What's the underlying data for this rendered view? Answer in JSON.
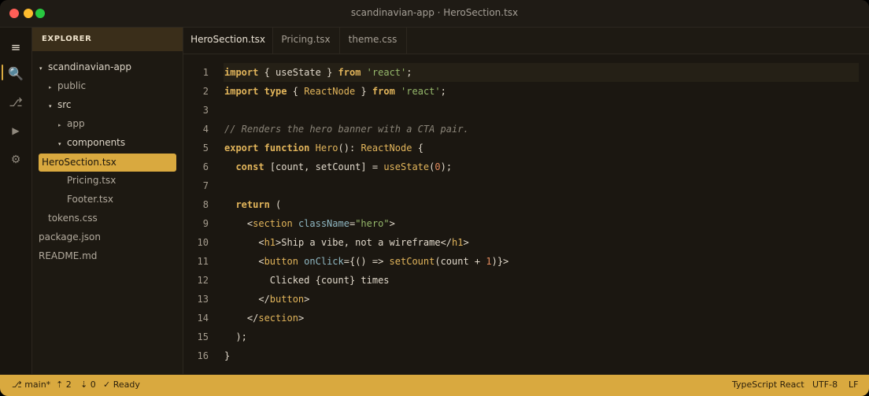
{
  "window": {
    "title": "scandinavian-app · HeroSection.tsx"
  },
  "activity": [
    {
      "icon": "menu-icon",
      "glyph": "≡"
    },
    {
      "icon": "search-icon",
      "glyph": "🔍"
    },
    {
      "icon": "source-control-icon",
      "glyph": "⎇"
    },
    {
      "icon": "run-icon",
      "glyph": "▶"
    },
    {
      "icon": "settings-icon",
      "glyph": "⚙"
    }
  ],
  "explorer": {
    "title": "EXPLORER",
    "tree": [
      {
        "label": "scandinavian-app",
        "caret": "▾"
      },
      {
        "label": "public",
        "caret": "▸"
      },
      {
        "label": "src",
        "caret": "▾"
      },
      {
        "label": "app",
        "caret": "▸"
      },
      {
        "label": "components",
        "caret": "▾"
      },
      {
        "label": "HeroSection.tsx",
        "caret": ""
      },
      {
        "label": "Pricing.tsx",
        "caret": ""
      },
      {
        "label": "Footer.tsx",
        "caret": ""
      },
      {
        "label": "tokens.css",
        "caret": ""
      },
      {
        "label": "package.json",
        "caret": ""
      },
      {
        "label": "README.md",
        "caret": ""
      }
    ]
  },
  "tabs": [
    {
      "label": "HeroSection.tsx",
      "active": true
    },
    {
      "label": "Pricing.tsx",
      "active": false
    },
    {
      "label": "theme.css",
      "active": false
    }
  ],
  "editor": {
    "line_numbers": [
      "1",
      "2",
      "3",
      "4",
      "5",
      "6",
      "7",
      "8",
      "9",
      "10",
      "11",
      "12",
      "13",
      "14",
      "15",
      "16"
    ],
    "tokens": {
      "import": "import",
      "type": "type",
      "from": "from",
      "export": "export",
      "function": "function",
      "const": "const",
      "return": "return",
      "use_state": "useState",
      "react_node": "ReactNode",
      "react_str": "'react'",
      "hero": "Hero",
      "comment": "// Renders the hero banner with a CTA pair.",
      "count_state": "[count, setCount]",
      "zero": "0",
      "one": "1",
      "section_tag": "section",
      "class_attr": "className",
      "hero_str": "\"hero\"",
      "h1_tag": "h1",
      "h1_text": "Ship a vibe, not a wireframe",
      "button_tag": "button",
      "onclick_attr": "onClick",
      "set_count": "setCount",
      "clicked_text": "Clicked {count} times"
    }
  },
  "status": {
    "branch": "main*",
    "ahead": "2",
    "behind": "0",
    "state": "Ready",
    "language": "TypeScript React",
    "encoding": "UTF-8",
    "eol": "LF"
  }
}
